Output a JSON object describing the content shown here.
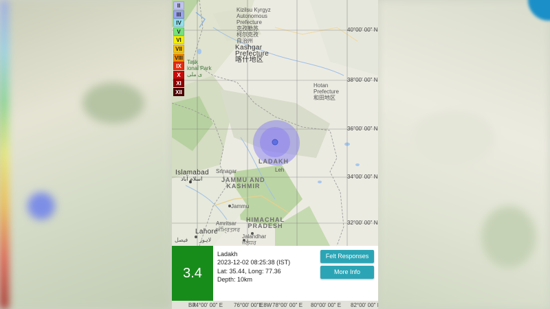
{
  "intensity_scale": [
    {
      "label": "II",
      "color": "#bfc3ee"
    },
    {
      "label": "III",
      "color": "#9aa4f2"
    },
    {
      "label": "IV",
      "color": "#8fe0ec"
    },
    {
      "label": "V",
      "color": "#79e07c"
    },
    {
      "label": "VI",
      "color": "#f4f000"
    },
    {
      "label": "VII",
      "color": "#f6c200"
    },
    {
      "label": "VIII",
      "color": "#f08f00"
    },
    {
      "label": "IX",
      "color": "#e52b0f"
    },
    {
      "label": "X",
      "color": "#c80a0a"
    },
    {
      "label": "XI",
      "color": "#8c0000"
    },
    {
      "label": "XII",
      "color": "#4a0000"
    }
  ],
  "map": {
    "lat_labels": [
      "40°00' 00\" N",
      "38°00' 00\" N",
      "36°00' 00\" N",
      "34°00' 00\" N",
      "32°00' 00\" N"
    ],
    "lon_labels": [
      "74°00' 00\" E",
      "76°00' 00\" E",
      "78°00' 00\" E",
      "80°00' 00\" E",
      "82°00' 00\" E"
    ],
    "places": {
      "kizilsu_en": "Kizilsu Kyrgyz",
      "kizilsu_en2": "Autonomous",
      "kizilsu_en3": "Prefecture",
      "kizilsu_cn1": "克孜勒苏",
      "kizilsu_cn2": "柯尔克孜",
      "kizilsu_cn3": "自治州",
      "kashgar1": "Kashgar",
      "kashgar2": "Prefecture",
      "kashgar_cn": "喀什地区",
      "hotan1": "Hotan",
      "hotan2": "Prefecture",
      "hotan_cn": "和田地区",
      "tajik1": "Tajik",
      "tajik2": "ional Park",
      "tajik_ur": "ی ملی",
      "ladakh": "LADAKH",
      "leh": "Leh",
      "islamabad": "Islamabad",
      "islamabad_ur": "اسلام آباد",
      "srinagar": "Srinagar",
      "jk1": "JAMMU AND",
      "jk2": "KASHMIR",
      "jammu": "Jammu",
      "amritsar": "Amritsar",
      "amritsar_ur": "ਅੰਮ੍ਰਿਤਸਰ",
      "lahore": "Lahore",
      "lahore_ur": "لاہور",
      "faisal": "فیصل",
      "jalandhar": "Jalandhar",
      "jalandhar_ur": "ਜਲੰਧਰ",
      "hp1": "HIMACHAL",
      "hp2": "PRADESH"
    }
  },
  "event": {
    "magnitude": "3.4",
    "location": "Ladakh",
    "datetime": "2023-12-02 08:25:38 (IST)",
    "coords": "Lat: 35.44, Long: 77.36",
    "depth": "Depth: 10km"
  },
  "buttons": {
    "felt": "Felt Responses",
    "more": "More Info"
  },
  "bottom_bar": [
    "Bik",
    "74°00' 00\" E",
    "76°00' 00\"E",
    "E8W",
    "78°00' 00\" E",
    "80°00' 00\" E",
    "82°00' 00\" E"
  ],
  "colors": {
    "magnitude_bg": "#188c1b",
    "button_bg": "#2ba5b5",
    "shake_area": "#8f86f0"
  }
}
